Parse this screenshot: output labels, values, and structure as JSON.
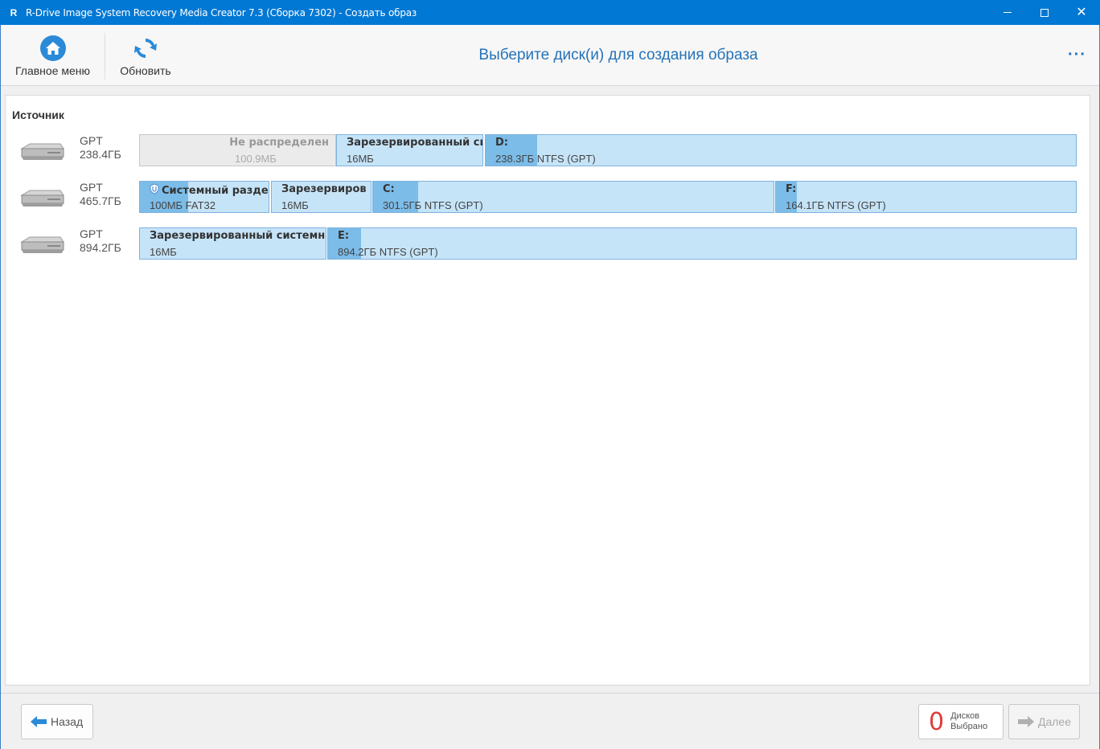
{
  "window": {
    "app_icon": "R",
    "title": "R-Drive Image System Recovery Media Creator 7.3 (Сборка 7302) - Создать образ",
    "minimize": "",
    "maximize": "",
    "close": "✕"
  },
  "toolbar": {
    "home_label": "Главное меню",
    "refresh_label": "Обновить",
    "heading": "Выберите диск(и) для создания образа",
    "more": "···"
  },
  "main": {
    "source_label": "Источник",
    "disks": [
      {
        "scheme": "GPT",
        "size": "238.4ГБ",
        "partitions": [
          {
            "name": "Не распределен",
            "info": "100.9МБ",
            "unallocated": true,
            "used": 0
          },
          {
            "name": "Зарезервированный си",
            "info": "16МБ",
            "used": 0
          },
          {
            "name": "D:",
            "info": "238.3ГБ NTFS (GPT)",
            "used": 0.087
          }
        ]
      },
      {
        "scheme": "GPT",
        "size": "465.7ГБ",
        "partitions": [
          {
            "name": "Системный разде",
            "info": "100МБ FAT32",
            "used": 0.37,
            "shield": true
          },
          {
            "name": "Зарезервиров",
            "info": "16МБ",
            "used": 0
          },
          {
            "name": "C:",
            "info": "301.5ГБ NTFS (GPT)",
            "used": 0.112
          },
          {
            "name": "F:",
            "info": "164.1ГБ NTFS (GPT)",
            "used": 0.07
          }
        ]
      },
      {
        "scheme": "GPT",
        "size": "894.2ГБ",
        "partitions": [
          {
            "name": "Зарезервированный системн",
            "info": "16МБ",
            "used": 0
          },
          {
            "name": "E:",
            "info": "894.2ГБ NTFS (GPT)",
            "used": 0.044
          }
        ]
      }
    ]
  },
  "footer": {
    "back_label": "Назад",
    "selected_count": "0",
    "selected_label_1": "Дисков",
    "selected_label_2": "Выбрано",
    "next_label": "Далее"
  },
  "colors": {
    "titlebar": "#0078d4",
    "accent": "#2673b8",
    "partition_fill": "#c6e4f8",
    "partition_used": "#7cbce8",
    "counter_red": "#e03b3b"
  }
}
